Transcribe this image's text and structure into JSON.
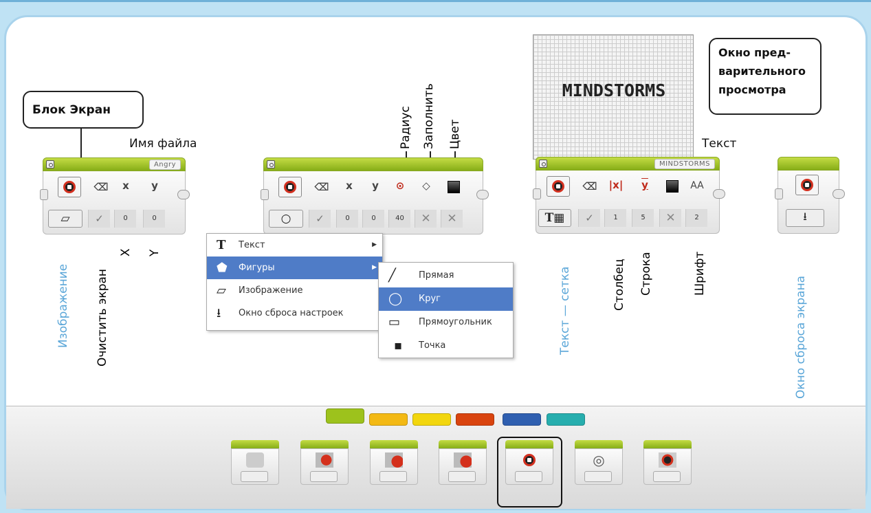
{
  "callouts": {
    "screen_block": "Блок Экран",
    "preview": [
      "Окно пред-",
      "варительного",
      "просмотра"
    ]
  },
  "labels": {
    "filename": "Имя файла",
    "radius": "Радиус",
    "fill": "Заполнить",
    "color": "Цвет",
    "text": "Текст",
    "image": "Изображение",
    "clear": "Очистить экран",
    "x": "X",
    "y": "Y",
    "text_grid": "Текст — сетка",
    "column": "Столбец",
    "row": "Строка",
    "font": "Шрифт",
    "reset_window": "Окно сброса экрана"
  },
  "block1": {
    "filename": "Angry",
    "x_label": "x",
    "y_label": "y",
    "x": "0",
    "y": "0"
  },
  "block2": {
    "x_label": "x",
    "y_label": "y",
    "x": "0",
    "y": "0",
    "radius": "40"
  },
  "block3": {
    "text": "MINDSTORMS",
    "column": "1",
    "row": "5",
    "font": "2",
    "font_icon": "AA"
  },
  "preview": {
    "text": "MINDSTORMS"
  },
  "menu": [
    {
      "icon": "T",
      "label": "Текст"
    },
    {
      "icon": "shapes-icon",
      "label": "Фигуры"
    },
    {
      "icon": "folder-icon",
      "label": "Изображение"
    },
    {
      "icon": "download-icon",
      "label": "Окно сброса настроек"
    }
  ],
  "submenu": [
    {
      "icon": "line-icon",
      "label": "Прямая"
    },
    {
      "icon": "circle-icon",
      "label": "Круг"
    },
    {
      "icon": "rectangle-icon",
      "label": "Прямоугольник"
    },
    {
      "icon": "point-icon",
      "label": "Точка"
    }
  ],
  "palette_tabs": [
    "#9dc21c",
    "#f3b914",
    "#f2d60e",
    "#d9440f",
    "#2f5fb0",
    "#27aeae"
  ]
}
